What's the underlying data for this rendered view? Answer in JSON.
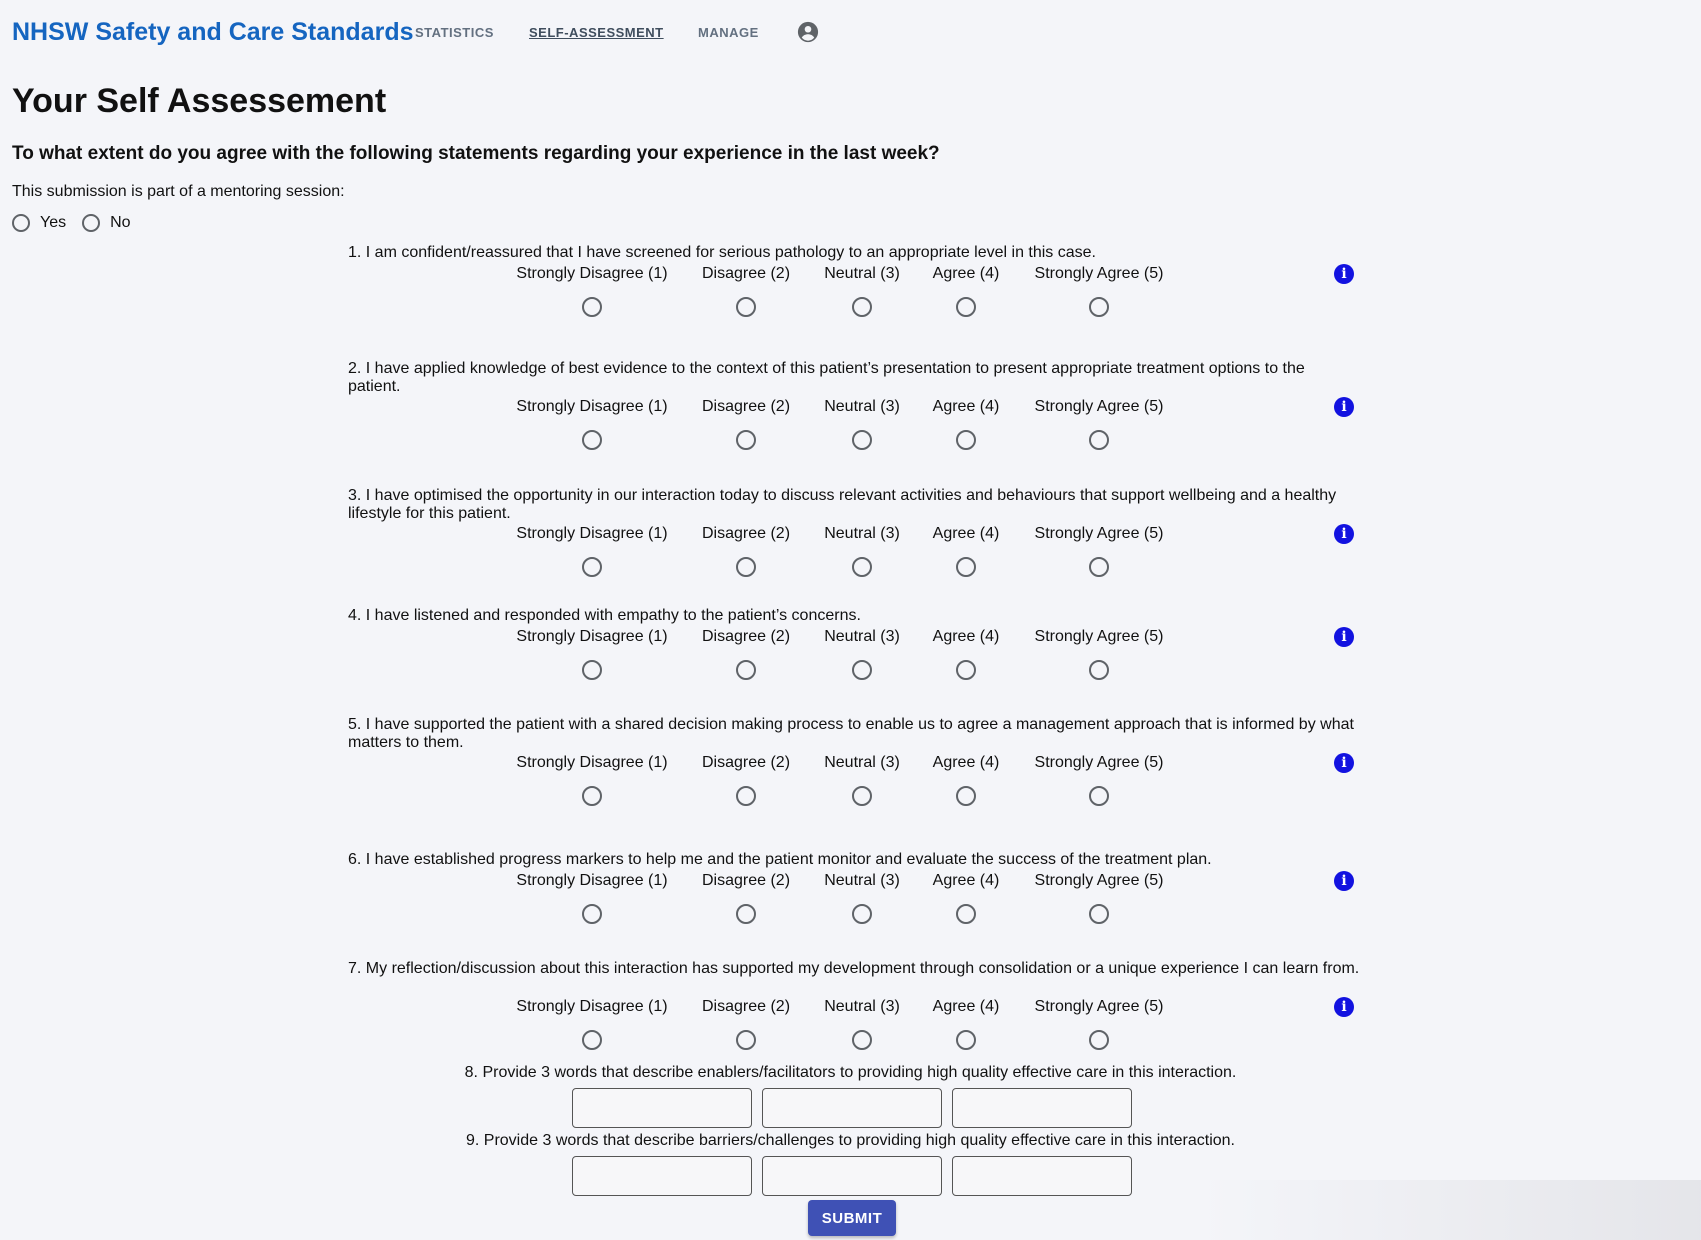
{
  "nav": {
    "brand": "NHSW Safety and Care Standards",
    "links": [
      "STATISTICS",
      "SELF-ASSESSMENT",
      "MANAGE"
    ],
    "account_icon": "account-circle-icon",
    "active": "SELF-ASSESSMENT"
  },
  "page": {
    "title": "Your Self Assessement",
    "question": "To what extent do you agree with the following statements regarding your experience in the last week?"
  },
  "mentoring": {
    "label": "This submission is part of a mentoring session:",
    "options": [
      "Yes",
      "No"
    ]
  },
  "scale": [
    "Strongly Disagree (1)",
    "Disagree (2)",
    "Neutral (3)",
    "Agree (4)",
    "Strongly Agree (5)"
  ],
  "info_icon": "info-icon",
  "questions": [
    "1. I am confident/reassured that I have screened for serious pathology to an appropriate level in this case.",
    "2. I have applied knowledge of best evidence to the context of this patient’s presentation to present appropriate treatment options to the patient.",
    "3. I have optimised the opportunity in our interaction today to discuss relevant activities and behaviours that support wellbeing and a healthy lifestyle for this patient.",
    "4. I have listened and responded with empathy to the patient’s concerns.",
    "5. I have supported the patient with a shared decision making process to enable us to agree a management approach that is informed by what matters to them.",
    "6. I have established progress markers to help me and the patient monitor and evaluate the success of the treatment plan.",
    "7. My reflection/discussion about this interaction has supported my development through consolidation or a unique experience I can learn from."
  ],
  "word_questions": [
    "8. Provide 3 words that describe enablers/facilitators to providing high quality effective care in this interaction.",
    "9. Provide 3 words that describe barriers/challenges to providing high quality effective care in this interaction."
  ],
  "word_inputs": [
    [
      "",
      "",
      ""
    ],
    [
      "",
      "",
      ""
    ]
  ],
  "submit_label": "SUBMIT",
  "colors": {
    "brand": "#1565c0",
    "info": "#1212e0",
    "submit": "#3f51b5"
  }
}
